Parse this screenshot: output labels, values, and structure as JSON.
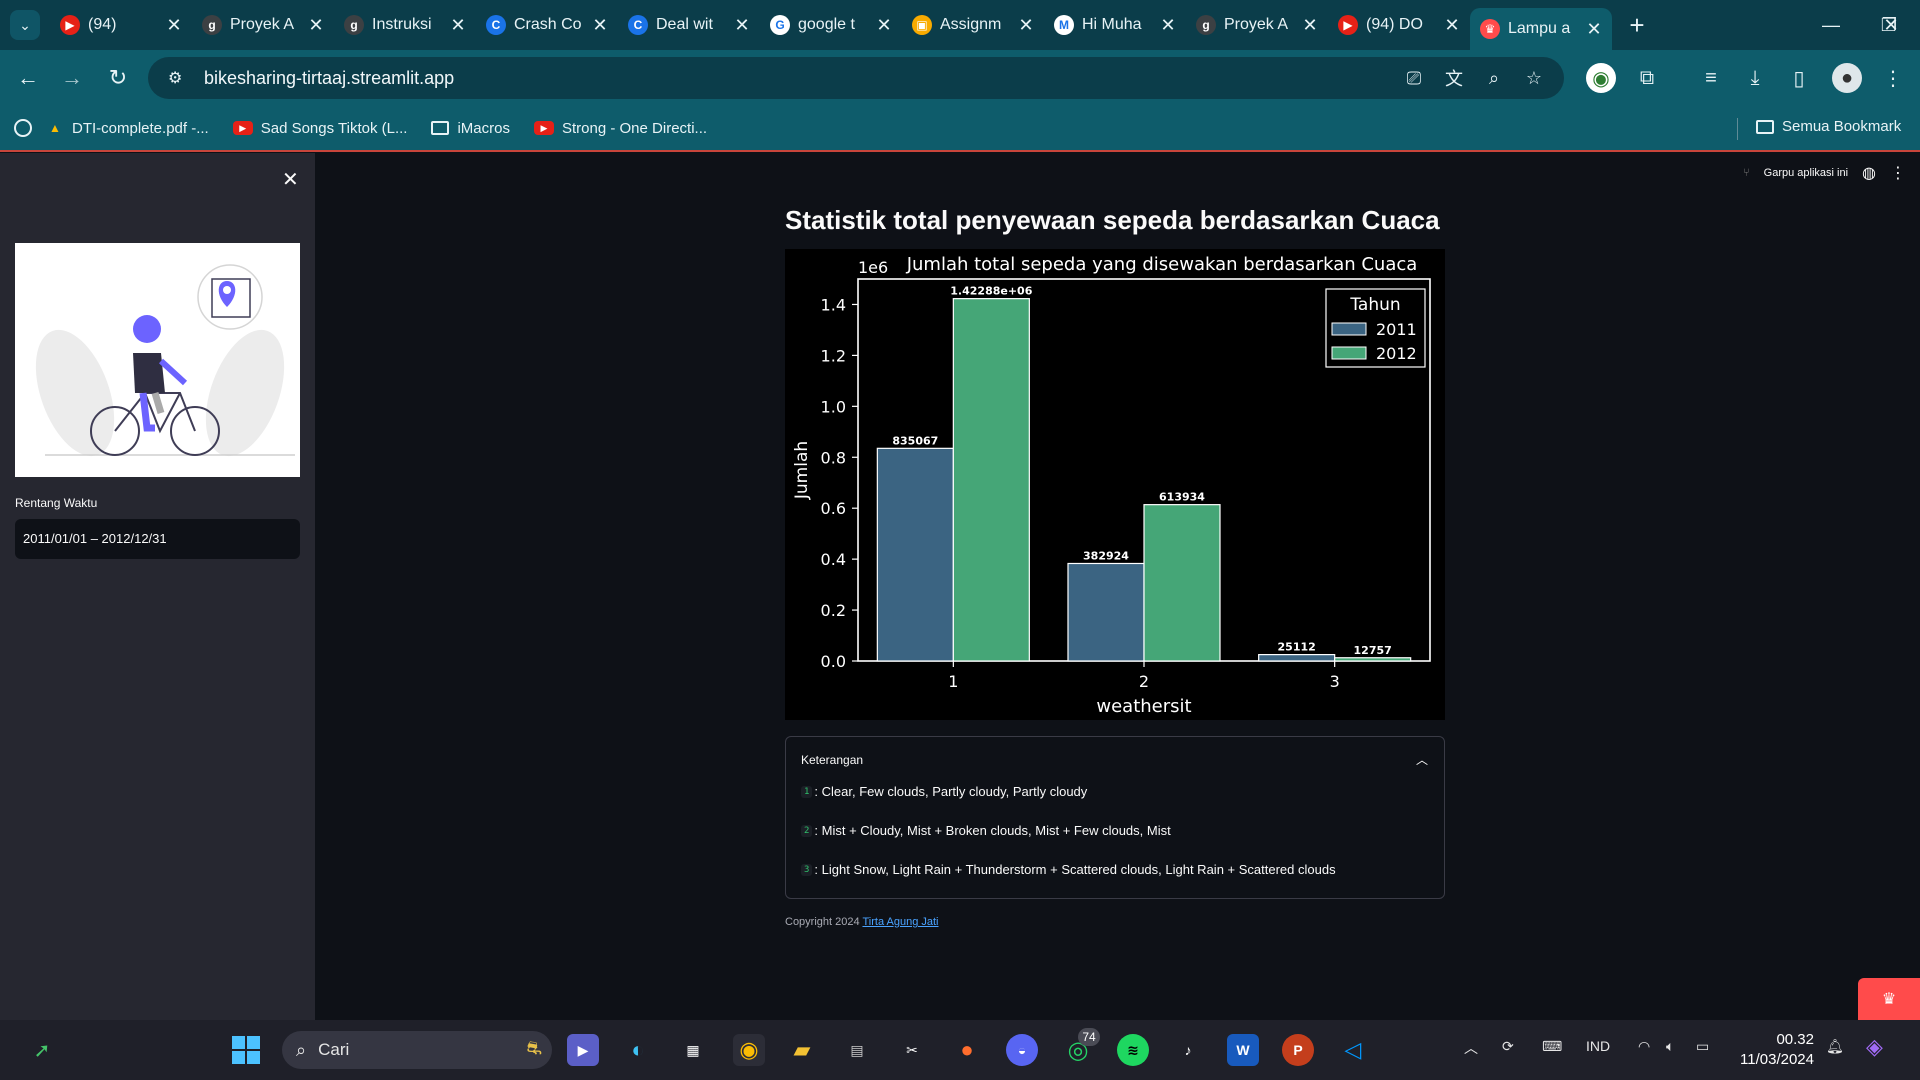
{
  "browser": {
    "tabs": [
      {
        "title": "(94)",
        "icon": "youtube-icon",
        "color": "#e62117"
      },
      {
        "title": "Proyek A",
        "icon": "g-icon",
        "color": "#3c4043"
      },
      {
        "title": "Instruksi",
        "icon": "g-icon",
        "color": "#3c4043"
      },
      {
        "title": "Crash Co",
        "icon": "c-icon",
        "color": "#1a73e8"
      },
      {
        "title": "Deal wit",
        "icon": "c-icon",
        "color": "#1a73e8"
      },
      {
        "title": "google t",
        "icon": "google-icon",
        "color": "#ffffff"
      },
      {
        "title": "Assignm",
        "icon": "classroom-icon",
        "color": "#f9ab00"
      },
      {
        "title": "Hi Muha",
        "icon": "gmail-icon",
        "color": "#ffffff"
      },
      {
        "title": "Proyek A",
        "icon": "g-icon",
        "color": "#3c4043"
      },
      {
        "title": "(94) DO",
        "icon": "youtube-icon",
        "color": "#e62117"
      },
      {
        "title": "Lampu a",
        "icon": "streamlit-icon",
        "color": "#ff4b4b"
      }
    ],
    "url": "bikesharing-tirtaaj.streamlit.app",
    "bookmarks": [
      {
        "label": "DTI-complete.pdf -...",
        "icon": "drive-icon"
      },
      {
        "label": "Sad Songs Tiktok (L...",
        "icon": "youtube-icon"
      },
      {
        "label": "iMacros",
        "icon": "folder-icon"
      },
      {
        "label": "Strong - One Directi...",
        "icon": "youtube-icon"
      }
    ],
    "all_bookmarks": "Semua Bookmark"
  },
  "sidebar": {
    "date_label": "Rentang Waktu",
    "date_value": "2011/01/01 – 2012/12/31"
  },
  "header": {
    "fork_label": "Garpu aplikasi ini"
  },
  "page": {
    "title": "Statistik total penyewaan sepeda berdasarkan Cuaca"
  },
  "expander": {
    "title": "Keterangan",
    "items": [
      {
        "code": "1",
        "text": ": Clear, Few clouds, Partly cloudy, Partly cloudy"
      },
      {
        "code": "2",
        "text": ": Mist + Cloudy, Mist + Broken clouds, Mist + Few clouds, Mist"
      },
      {
        "code": "3",
        "text": ": Light Snow, Light Rain + Thunderstorm + Scattered clouds, Light Rain + Scattered clouds"
      }
    ]
  },
  "footer": {
    "copyright": "Copyright 2024",
    "author": "Tirta Agung Jati"
  },
  "taskbar": {
    "search": "Cari",
    "lang": "IND",
    "time": "00.32",
    "date": "11/03/2024",
    "whatsapp_badge": "74"
  },
  "chart_data": {
    "type": "bar",
    "title": "Jumlah total sepeda yang disewakan berdasarkan Cuaca",
    "xlabel": "weathersit",
    "ylabel": "Jumlah",
    "offset_label": "1e6",
    "categories": [
      "1",
      "2",
      "3"
    ],
    "ylim": [
      0,
      1.5
    ],
    "yticks": [
      "0.0",
      "0.2",
      "0.4",
      "0.6",
      "0.8",
      "1.0",
      "1.2",
      "1.4"
    ],
    "legend_title": "Tahun",
    "legend_position": "top-right",
    "series": [
      {
        "name": "2011",
        "color": "#3b6482",
        "values": [
          835067,
          382924,
          25112
        ],
        "labels": [
          "835067",
          "382924",
          "25112"
        ]
      },
      {
        "name": "2012",
        "color": "#45a677",
        "values": [
          1422880,
          613934,
          12757
        ],
        "labels": [
          "1.42288e+06",
          "613934",
          "12757"
        ]
      }
    ]
  }
}
